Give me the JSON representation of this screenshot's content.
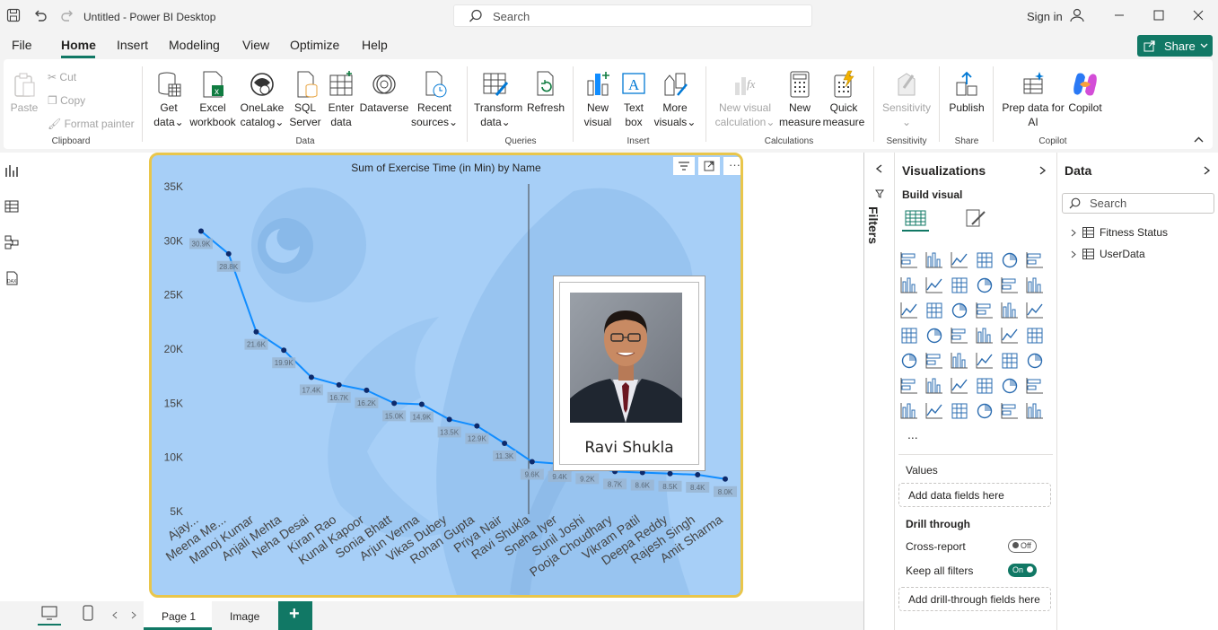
{
  "titlebar": {
    "title": "Untitled - Power BI Desktop",
    "search_placeholder": "Search",
    "signin": "Sign in"
  },
  "menu": {
    "items": [
      "File",
      "Home",
      "Insert",
      "Modeling",
      "View",
      "Optimize",
      "Help"
    ],
    "active": "Home",
    "share": "Share"
  },
  "ribbon": {
    "clipboard": {
      "paste": "Paste",
      "cut": "Cut",
      "copy": "Copy",
      "format_painter": "Format painter",
      "label": "Clipboard"
    },
    "data": {
      "get_data_1": "Get",
      "get_data_2": "data",
      "excel_1": "Excel",
      "excel_2": "workbook",
      "onelake_1": "OneLake",
      "onelake_2": "catalog",
      "sql_1": "SQL",
      "sql_2": "Server",
      "enter_1": "Enter",
      "enter_2": "data",
      "dataverse": "Dataverse",
      "recent_1": "Recent",
      "recent_2": "sources",
      "label": "Data"
    },
    "queries": {
      "transform_1": "Transform",
      "transform_2": "data",
      "refresh": "Refresh",
      "label": "Queries"
    },
    "insert": {
      "newvisual_1": "New",
      "newvisual_2": "visual",
      "textbox_1": "Text",
      "textbox_2": "box",
      "more_1": "More",
      "more_2": "visuals",
      "label": "Insert"
    },
    "calculations": {
      "nvc_1": "New visual",
      "nvc_2": "calculation",
      "nm_1": "New",
      "nm_2": "measure",
      "qm_1": "Quick",
      "qm_2": "measure",
      "label": "Calculations"
    },
    "sensitivity": {
      "btn": "Sensitivity",
      "label": "Sensitivity"
    },
    "share": {
      "publish": "Publish",
      "label": "Share"
    },
    "copilot": {
      "prep_1": "Prep data for",
      "prep_2": "AI",
      "copilot": "Copilot",
      "label": "Copilot"
    }
  },
  "chart_data": {
    "type": "line",
    "title": "Sum of Exercise Time (in Min) by Name",
    "categories": [
      "Ajay...",
      "Meena Me...",
      "Manoj Kumar",
      "Anjali Mehta",
      "Neha Desai",
      "Kiran Rao",
      "Kunal Kapoor",
      "Sonia Bhatt",
      "Arjun Verma",
      "Vikas Dubey",
      "Rohan Gupta",
      "Priya Nair",
      "Ravi Shukla",
      "Sneha Iyer",
      "Sunil Joshi",
      "Pooja Choudhary",
      "Vikram Patil",
      "Deepa Reddy",
      "Rajesh Singh",
      "Amit Sharma"
    ],
    "values": [
      30900,
      28800,
      21600,
      19900,
      17400,
      16700,
      16200,
      15000,
      14900,
      13500,
      12900,
      11300,
      9600,
      9400,
      9200,
      8700,
      8600,
      8500,
      8400,
      8000
    ],
    "data_labels": [
      "30.9K",
      "28.8K",
      "21.6K",
      "19.9K",
      "17.4K",
      "16.7K",
      "16.2K",
      "15.0K",
      "14.9K",
      "13.5K",
      "12.9K",
      "11.3K",
      "9.6K",
      "9.4K",
      "9.2K",
      "8.7K",
      "8.6K",
      "8.5K",
      "8.4K",
      "8.0K"
    ],
    "yticks": [
      "35K",
      "30K",
      "25K",
      "20K",
      "15K",
      "10K",
      "5K"
    ],
    "ylim": [
      5000,
      35000
    ],
    "line_color": "#118dff",
    "grid": false
  },
  "tooltip": {
    "name": "Ravi Shukla"
  },
  "filters": {
    "label": "Filters"
  },
  "viz_pane": {
    "title": "Visualizations",
    "build_visual": "Build visual",
    "more": "...",
    "values_label": "Values",
    "values_placeholder": "Add data fields here",
    "drill_through": "Drill through",
    "cross_report": "Cross-report",
    "cross_report_state": "Off",
    "keep_filters": "Keep all filters",
    "keep_filters_state": "On",
    "drill_placeholder": "Add drill-through fields here"
  },
  "data_pane": {
    "title": "Data",
    "search_placeholder": "Search",
    "tables": [
      "Fitness Status",
      "UserData"
    ]
  },
  "pages": {
    "tabs": [
      "Page 1",
      "Image"
    ],
    "active": "Page 1",
    "add": "+"
  },
  "colors": {
    "accent": "#117865",
    "visual_bg": "#a7cff7",
    "border": "#e9c64b"
  }
}
